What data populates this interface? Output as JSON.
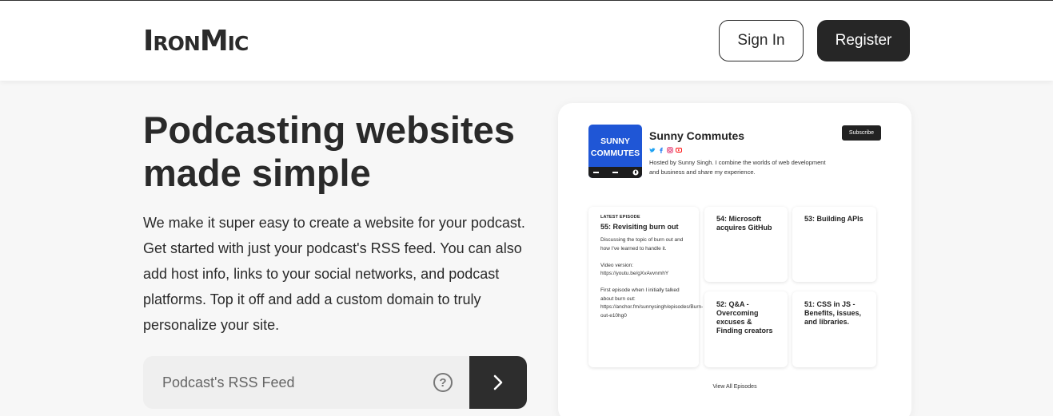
{
  "header": {
    "logo": "IronMic",
    "signin_label": "Sign In",
    "register_label": "Register"
  },
  "hero": {
    "title": "Podcasting websites made simple",
    "description": "We make it super easy to create a website for your podcast. Get started with just your podcast's RSS feed. You can also add host info, links to your social networks, and podcast platforms. Top it off and add a custom domain to truly personalize your site."
  },
  "rss_form": {
    "placeholder": "Podcast's RSS Feed",
    "help_glyph": "?",
    "submit_icon": "chevron-right-icon"
  },
  "preview": {
    "cover_text": "SUNNY COMMUTES",
    "show_title": "Sunny Commutes",
    "socials": [
      "twitter-icon",
      "facebook-icon",
      "instagram-icon",
      "youtube-icon"
    ],
    "host_description": "Hosted by Sunny Singh. I combine the worlds of web development and business and share my experience.",
    "subscribe_label": "Subscribe",
    "latest_label": "LATEST EPISODE",
    "latest": {
      "title": "55: Revisiting burn out",
      "body": "Discussing the topic of burn out and how I've learned to handle it.\n\nVideo version: https://youtu.be/gXvAvvnmhY\n\nFirst episode when I initially talked about burn out: https://anchor.fm/sunnysingh/episodes/Burn-out-e10hg0"
    },
    "episodes": [
      {
        "title": "54: Microsoft acquires GitHub"
      },
      {
        "title": "53: Building APIs"
      },
      {
        "title": "52: Q&A - Overcoming excuses & Finding creators"
      },
      {
        "title": "51: CSS in JS - Benefits, issues, and libraries."
      }
    ],
    "view_all_label": "View All Episodes"
  },
  "colors": {
    "dark": "#262626",
    "cover_blue": "#1f56d6",
    "twitter": "#1da1f2",
    "facebook": "#1877f2",
    "instagram": "#e1306c",
    "youtube": "#ff0000"
  }
}
